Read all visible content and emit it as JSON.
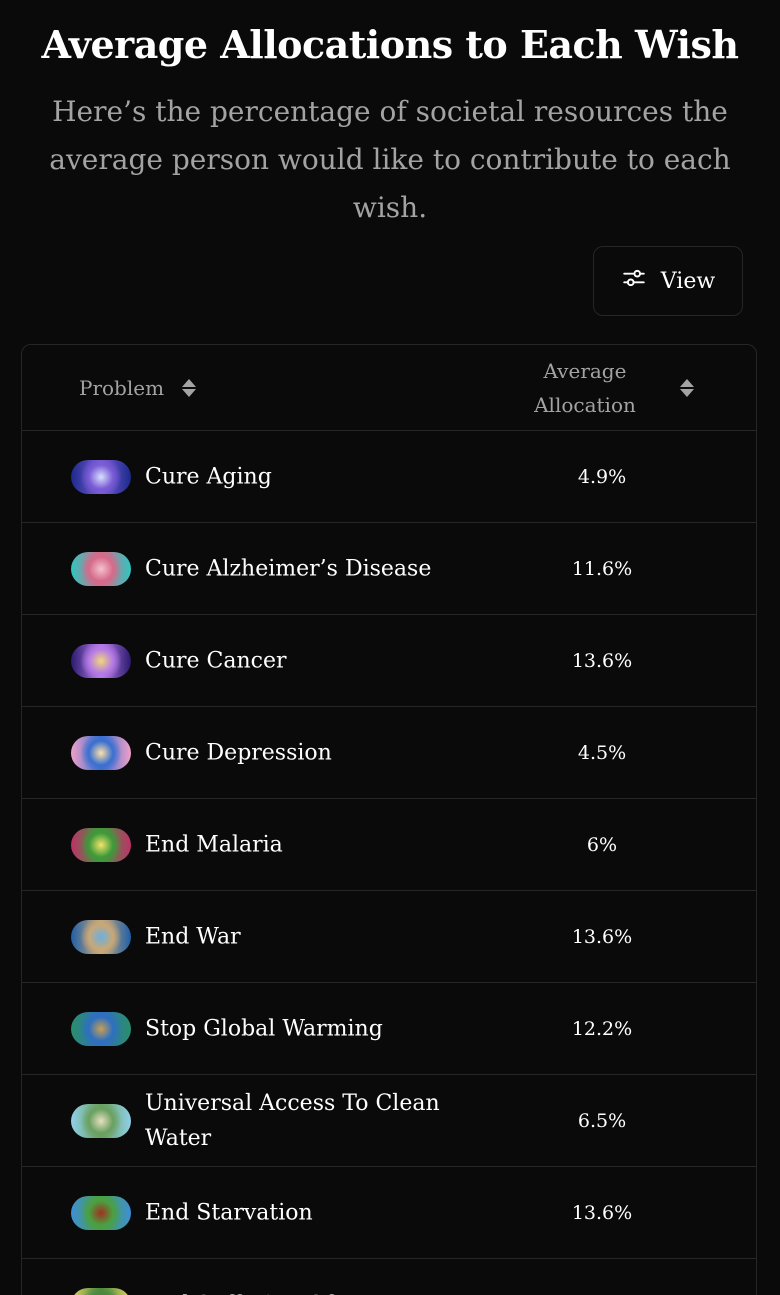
{
  "header": {
    "title": "Average Allocations to Each Wish",
    "subtitle": "Here’s the percentage of societal resources the average person would like to contribute to each wish."
  },
  "toolbar": {
    "view_label": "View"
  },
  "table": {
    "columns": {
      "problem": "Problem",
      "allocation": "Average Allocation"
    },
    "rows": [
      {
        "name": "Cure Aging",
        "value": "4.9%",
        "colors": [
          "#1b2a8a",
          "#7a5cd6",
          "#d8e0ff"
        ]
      },
      {
        "name": "Cure Alzheimer’s Disease",
        "value": "11.6%",
        "colors": [
          "#2fc7c0",
          "#d66a8a",
          "#f4c2d0"
        ]
      },
      {
        "name": "Cure Cancer",
        "value": "13.6%",
        "colors": [
          "#2a1b6e",
          "#b57ae6",
          "#f3d67a"
        ]
      },
      {
        "name": "Cure Depression",
        "value": "4.5%",
        "colors": [
          "#f2a0c8",
          "#3a6fd0",
          "#ffe1a8"
        ]
      },
      {
        "name": "End Malaria",
        "value": "6%",
        "colors": [
          "#c0306a",
          "#3e9a3a",
          "#f3e46a"
        ]
      },
      {
        "name": "End War",
        "value": "13.6%",
        "colors": [
          "#1f5fa8",
          "#c8a878",
          "#6ab0e0"
        ]
      },
      {
        "name": "Stop Global Warming",
        "value": "12.2%",
        "colors": [
          "#2a8f6a",
          "#2f6fc0",
          "#c9a052"
        ]
      },
      {
        "name": "Universal Access To Clean Water",
        "value": "6.5%",
        "colors": [
          "#8fd0e8",
          "#6aa060",
          "#e6e0c0"
        ]
      },
      {
        "name": "End Starvation",
        "value": "13.6%",
        "colors": [
          "#3e8fd8",
          "#4aa040",
          "#a03020"
        ]
      },
      {
        "name": "End Suffering Of Factory",
        "value": "",
        "colors": [
          "#e0d060",
          "#4a8a40",
          "#c04030"
        ]
      }
    ]
  }
}
